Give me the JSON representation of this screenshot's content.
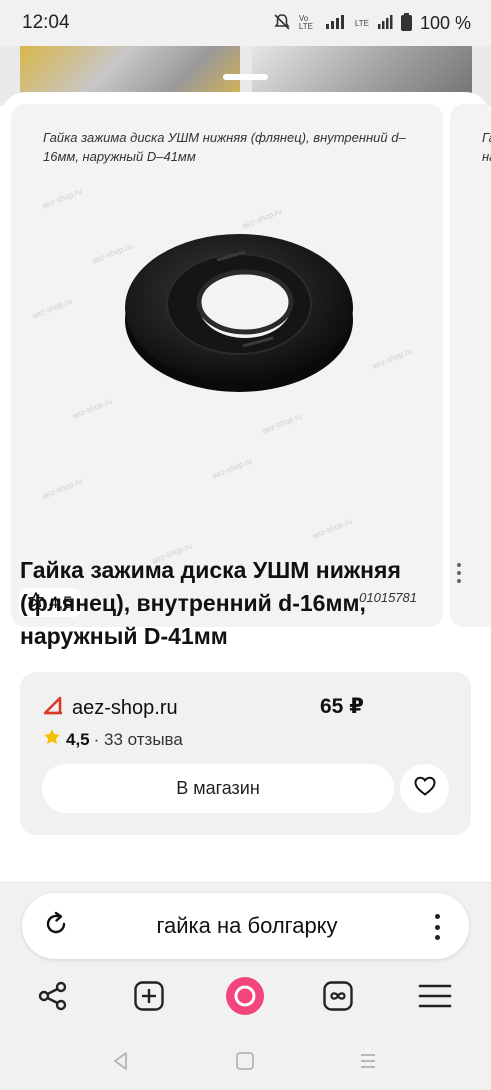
{
  "status_bar": {
    "time": "12:04",
    "battery": "100 %",
    "network_label": "LTE",
    "volte_label": "Vo LTE"
  },
  "product": {
    "image_caption": "Гайка зажима диска УШМ нижняя (флянец), внутренний d–16мм, наружный D–41мм",
    "image_code": "01015781",
    "image_watermark": "aez-shop.ru",
    "peek_caption": "Га\nна",
    "image_rating": "4,5",
    "title": "Гайка зажима диска УШМ нижняя (флянец), внутренний d-16мм, наружный D-41мм"
  },
  "offer": {
    "shop_name": "aez-shop.ru",
    "price": "65 ₽",
    "rating": "4,5",
    "reviews": "· 33 отзыва",
    "shop_button_label": "В магазин",
    "accent_color": "#d93a2b",
    "star_color": "#f5c000"
  },
  "search": {
    "query": "гайка на болгарку"
  },
  "toolbar": {
    "items": [
      "share-icon",
      "new-tab-icon",
      "alice-icon",
      "tabs-icon",
      "menu-icon"
    ],
    "alice_color": "#f2457c"
  },
  "navigation": {
    "items": [
      "back-icon",
      "home-icon",
      "recent-apps-icon"
    ]
  }
}
